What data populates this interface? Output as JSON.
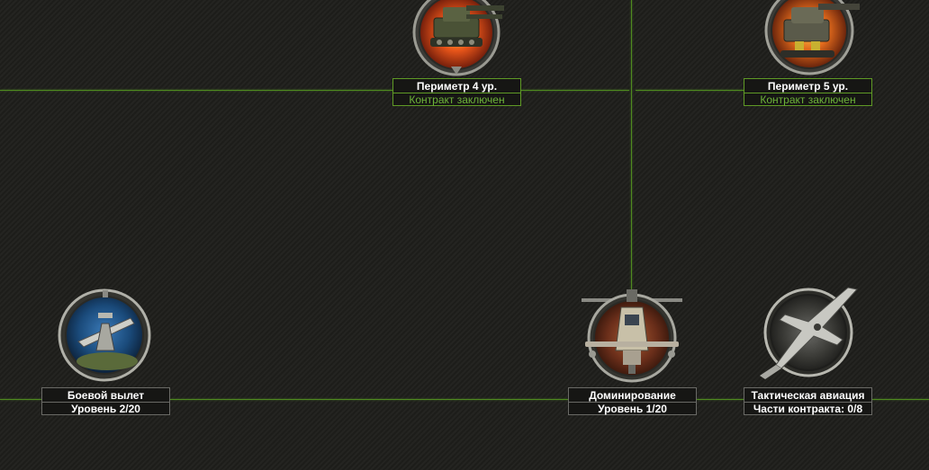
{
  "nodes": {
    "perimeter4": {
      "title": "Периметр 4 ур.",
      "status": "Контракт заключен"
    },
    "perimeter5": {
      "title": "Периметр 5 ур.",
      "status": "Контракт заключен"
    },
    "combat_sortie": {
      "title": "Боевой вылет",
      "status": "Уровень 2/20"
    },
    "domination": {
      "title": "Доминирование",
      "status": "Уровень 1/20"
    },
    "tactical_aviation": {
      "title": "Тактическая авиация",
      "status": "Части контракта: 0/8"
    }
  },
  "colors": {
    "connector_line": "#4f8a1f",
    "accent_text": "#6db33a",
    "background": "#1f1f1c"
  }
}
